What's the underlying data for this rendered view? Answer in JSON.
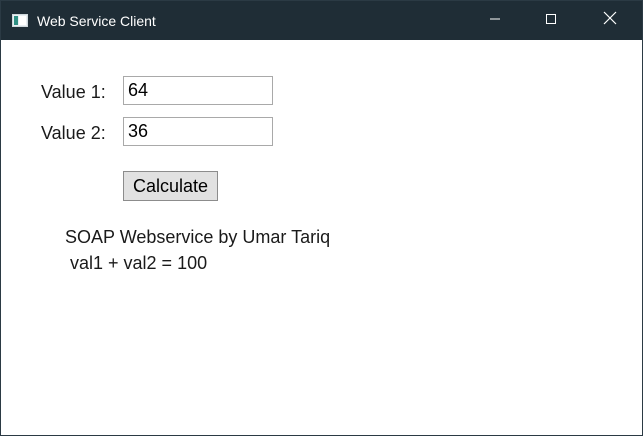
{
  "window": {
    "title": "Web Service Client",
    "titlebar_color": "#1f2d36"
  },
  "form": {
    "value1_label": "Value 1:",
    "value1": "64",
    "value2_label": "Value 2:",
    "value2": "36",
    "calculate_label": "Calculate"
  },
  "output": {
    "line1": "SOAP Webservice by Umar Tariq",
    "line2": "val1 + val2 = 100"
  },
  "icons": {
    "app": "app-window-icon",
    "minimize": "minimize-icon",
    "maximize": "maximize-icon",
    "close": "close-icon"
  }
}
